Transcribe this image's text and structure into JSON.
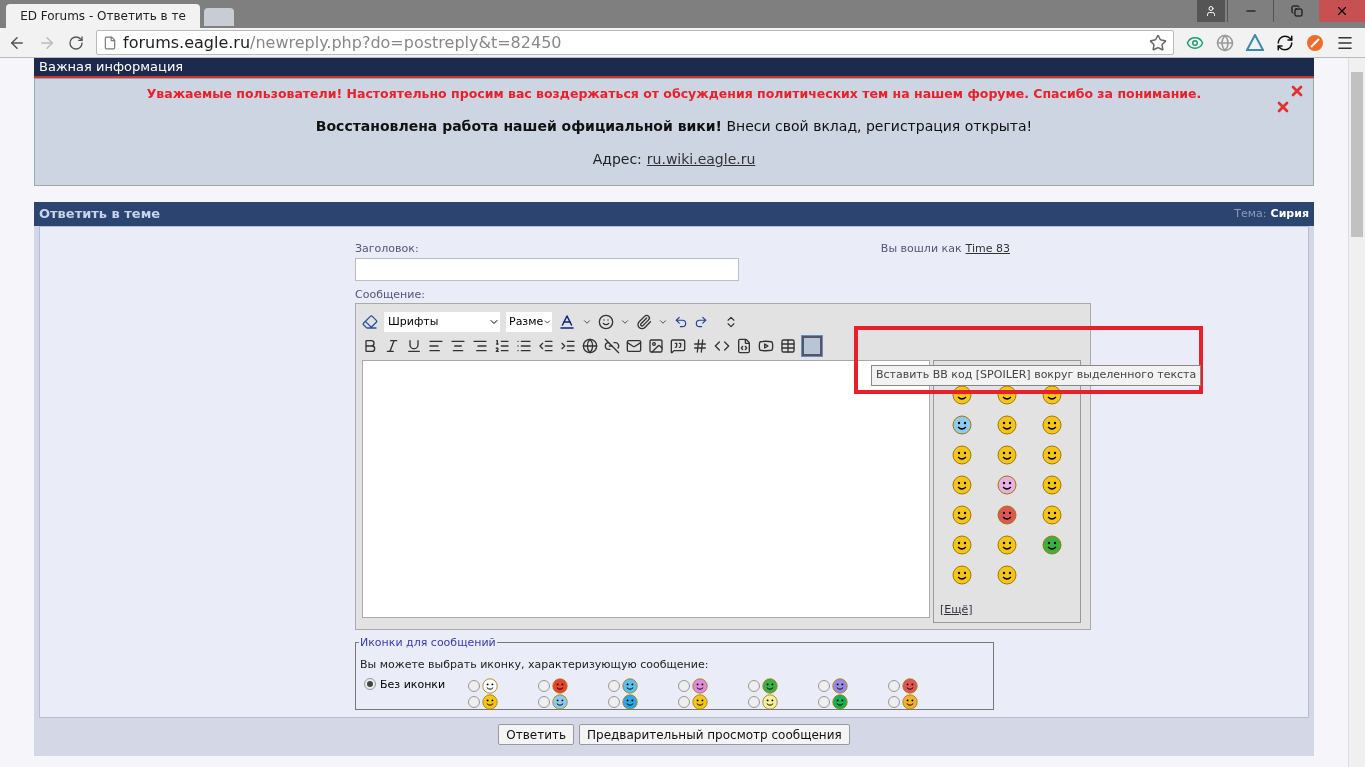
{
  "browser": {
    "tab_title": "ED Forums - Ответить в те",
    "url_host": "forums.eagle.ru",
    "url_path": "/newreply.php?do=postreply&t=82450"
  },
  "notice": {
    "title": "Важная информация",
    "warning": "Уважаемые пользователи! Настоятельно просим вас воздержаться от обсуждения политических тем на нашем форуме. Спасибо за понимание.",
    "wiki": "**Восстановлена работа нашей официальной вики!** Внеси свой вклад, регистрация открыта!",
    "address_label": "Адрес:",
    "address_link": "ru.wiki.eagle.ru"
  },
  "reply": {
    "title": "Ответить в теме",
    "topic_label": "Тема:",
    "topic": "Сирия"
  },
  "form": {
    "title_label": "Заголовок:",
    "logged_in_label": "Вы вошли как",
    "user": "Time 83",
    "message_label": "Сообщение:",
    "font_select": "Шрифты",
    "size_select": "Разме",
    "tooltip": "Вставить BB код [SPOILER] вокруг выделенного текста",
    "more_smilies": "[Ещё]"
  },
  "message_icons": {
    "legend": "Иконки для сообщений",
    "hint": "Вы можете выбрать иконку, характеризующую сообщение:",
    "none_label": "Без иконки",
    "none_selected": true,
    "options": [
      {
        "selected": false
      },
      {
        "selected": false
      },
      {
        "selected": false
      },
      {
        "selected": false
      },
      {
        "selected": false
      },
      {
        "selected": false
      },
      {
        "selected": false
      },
      {
        "selected": false
      },
      {
        "selected": false
      },
      {
        "selected": false
      },
      {
        "selected": false
      },
      {
        "selected": false
      },
      {
        "selected": false
      },
      {
        "selected": false
      }
    ]
  },
  "buttons": [
    "Ответить",
    "Предварительный просмотр сообщения"
  ]
}
